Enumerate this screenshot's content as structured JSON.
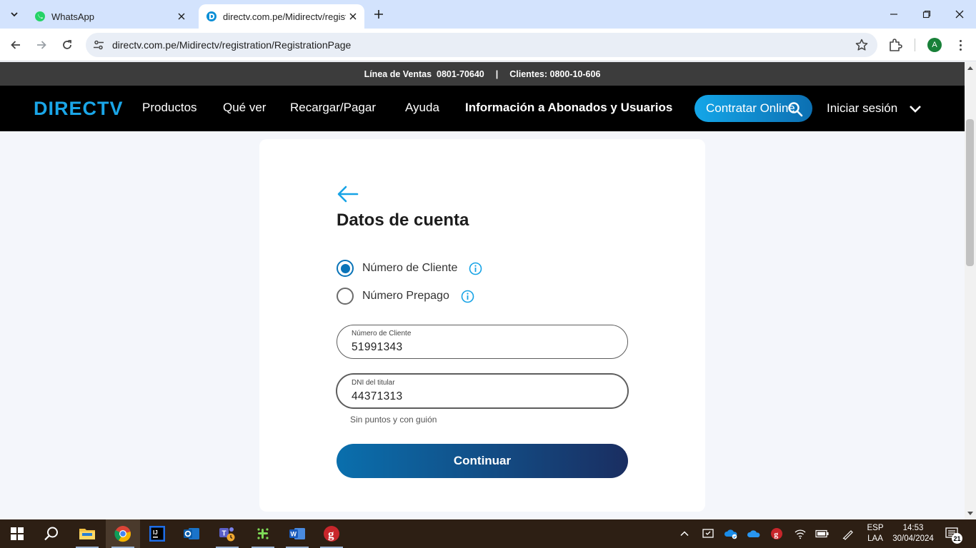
{
  "browser": {
    "tabs": [
      {
        "title": "WhatsApp",
        "icon": "whatsapp-icon",
        "active": false
      },
      {
        "title": "directv.com.pe/Midirectv/regist",
        "icon": "directv-favicon",
        "active": true
      }
    ],
    "url": "directv.com.pe/Midirectv/registration/RegistrationPage",
    "profile_initial": "A"
  },
  "site": {
    "topbar": {
      "sales": "Línea de Ventas  0801-70640",
      "separator": "|",
      "clients": "Clientes: 0800-10-606"
    },
    "nav": {
      "logo_text": "DIRECTV",
      "items": [
        "Productos",
        "Qué ver",
        "Recargar/Pagar",
        "Ayuda",
        "Información a Abonados y Usuarios"
      ],
      "cta": "Contratar Online",
      "login": "Iniciar sesión"
    },
    "colors": {
      "accent": "#14a6e8",
      "brand_dark": "#1a2e61",
      "radio": "#0a74b8"
    }
  },
  "form": {
    "title": "Datos de cuenta",
    "options": [
      {
        "label": "Número de Cliente",
        "selected": true
      },
      {
        "label": "Número Prepago",
        "selected": false
      }
    ],
    "fields": [
      {
        "label": "Número de Cliente",
        "value": "51991343"
      },
      {
        "label": "DNI del titular",
        "value": "44371313"
      }
    ],
    "hint": "Sin puntos y con guión",
    "submit": "Continuar"
  },
  "taskbar": {
    "apps": [
      "windows-start-icon",
      "search-icon",
      "file-explorer-icon",
      "chrome-icon",
      "intellij-icon",
      "outlook-icon",
      "teams-icon",
      "slack-icon",
      "word-icon",
      "app-icon"
    ],
    "language": [
      "ESP",
      "LAA"
    ],
    "time": "14:53",
    "date": "30/04/2024",
    "notifications": "21"
  }
}
